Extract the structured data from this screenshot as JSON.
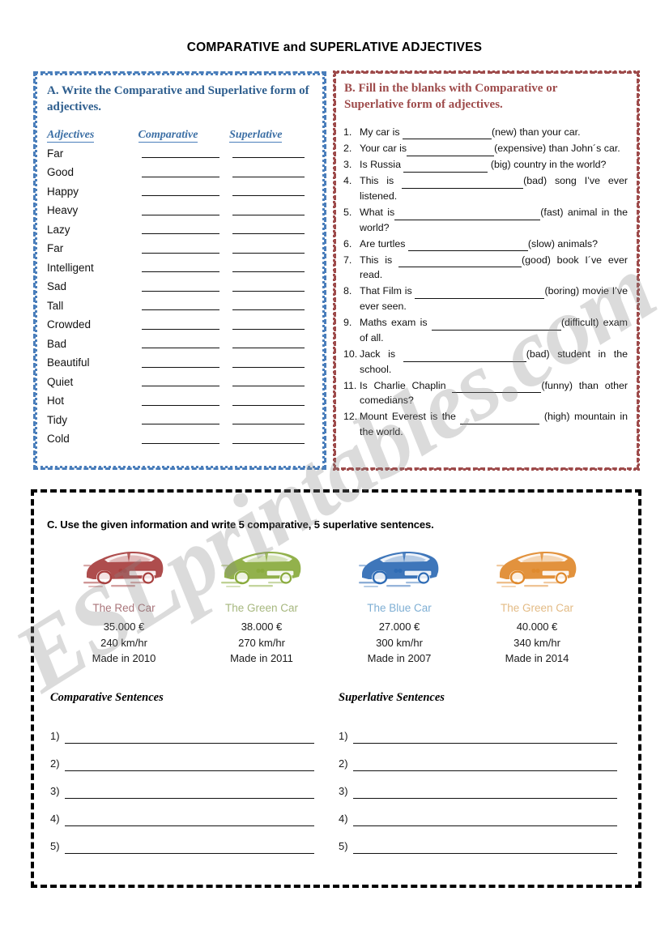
{
  "page": {
    "title": "COMPARATIVE and SUPERLATIVE ADJECTIVES",
    "watermark": "ESLprintables.com"
  },
  "colors": {
    "panel_a_border": "#4a7ebb",
    "panel_a_heading": "#2e5e8e",
    "panel_b_border": "#9e4b4b",
    "panel_b_heading": "#9e4b4b",
    "panel_c_border": "#000000",
    "red_car": "#a8403f",
    "green_car": "#8aab3e",
    "blue_car": "#2f6cb5",
    "orange_car": "#e08a2e"
  },
  "section_a": {
    "heading": "A. Write the Comparative and Superlative form of adjectives.",
    "columns": [
      "Adjectives",
      "Comparative",
      "Superlative"
    ],
    "adjectives": [
      "Far",
      "Good",
      "Happy",
      "Heavy",
      "Lazy",
      "Far",
      "Intelligent",
      "Sad",
      "Tall",
      "Crowded",
      "Bad",
      "Beautiful",
      "Quiet",
      "Hot",
      "Tidy",
      "Cold"
    ]
  },
  "section_b": {
    "heading_line1": "B. Fill in the blanks with Comparative or",
    "heading_line2": "Superlative form of adjectives.",
    "items": [
      {
        "num": "1.",
        "before": "My car is ",
        "blank": 110,
        "after": "(new) than your car."
      },
      {
        "num": "2.",
        "before": "Your car is",
        "blank": 108,
        "after": "(expensive) than John´s car."
      },
      {
        "num": "3.",
        "before": "Is Russia ",
        "blank": 104,
        "after": " (big) country in the world?"
      },
      {
        "num": "4.",
        "before": "This is ",
        "blank": 150,
        "after": "(bad) song I’ve ever listened."
      },
      {
        "num": "5.",
        "before": "What is",
        "blank": 180,
        "after": "(fast) animal in the world?"
      },
      {
        "num": "6.",
        "before": "Are turtles ",
        "blank": 148,
        "after": "(slow) animals?"
      },
      {
        "num": "7.",
        "before": "This is ",
        "blank": 152,
        "after": "(good) book I´ve ever read."
      },
      {
        "num": "8.",
        "before": "That Film is ",
        "blank": 160,
        "after": "(boring) movie I’ve ever seen."
      },
      {
        "num": "9.",
        "before": "Maths exam is ",
        "blank": 160,
        "after": "(difficult) exam of all."
      },
      {
        "num": "10.",
        "before": "Jack is ",
        "blank": 152,
        "after": "(bad) student in the school."
      },
      {
        "num": "11.",
        "before": "Is Charlie Chaplin ",
        "blank": 110,
        "after": "(funny) than other comedians?"
      },
      {
        "num": "12.",
        "before": "Mount Everest is the ",
        "blank": 98,
        "after": " (high) mountain in the world."
      }
    ]
  },
  "section_c": {
    "heading": "C. Use the given information and  write 5 comparative, 5 superlative sentences.",
    "cars": [
      {
        "name": "The Red Car",
        "price": "35.000 €",
        "speed": "240 km/hr",
        "made": "Made in 2010",
        "color": "#a8403f",
        "label_color": "#a9757a"
      },
      {
        "name": "The Green Car",
        "price": "38.000 €",
        "speed": "270 km/hr",
        "made": "Made in 2011",
        "color": "#8aab3e",
        "label_color": "#a6b77e"
      },
      {
        "name": "The Blue Car",
        "price": "27.000 €",
        "speed": "300 km/hr",
        "made": "Made in 2007",
        "color": "#2f6cb5",
        "label_color": "#7fafd4"
      },
      {
        "name": "The Green Car",
        "price": "40.000 €",
        "speed": "340 km/hr",
        "made": "Made in 2014",
        "color": "#e08a2e",
        "label_color": "#e3bb85"
      }
    ],
    "comparative": {
      "title": "Comparative Sentences",
      "lines": [
        "1)",
        "2)",
        "3)",
        "4)",
        "5)"
      ]
    },
    "superlative": {
      "title": "Superlative Sentences",
      "lines": [
        "1)",
        "2)",
        "3)",
        "4)",
        "5)"
      ]
    }
  }
}
